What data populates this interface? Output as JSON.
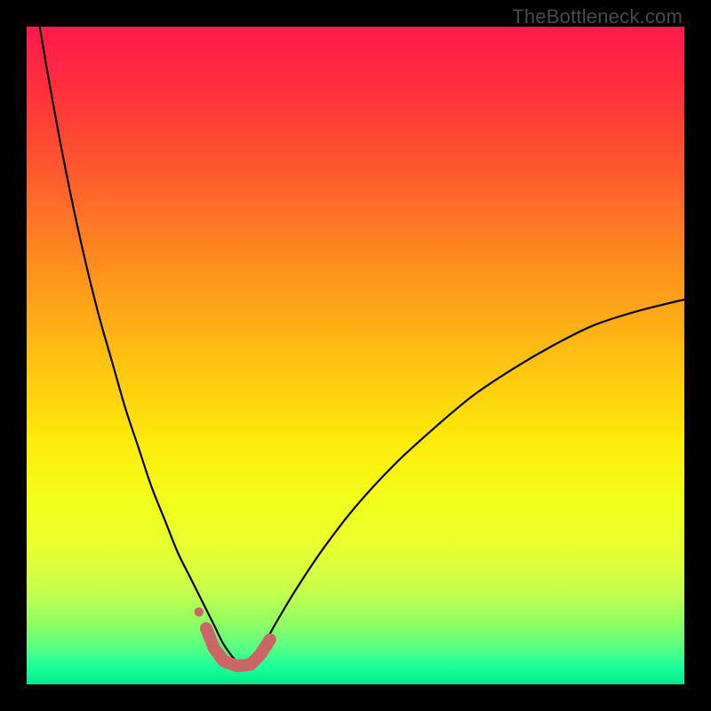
{
  "watermark": "TheBottleneck.com",
  "chart_data": {
    "type": "line",
    "title": "",
    "xlabel": "",
    "ylabel": "",
    "xlim": [
      0,
      1
    ],
    "ylim": [
      0,
      1
    ],
    "background_gradient": {
      "description": "Vertical gradient from red (top) through orange/yellow to green (bottom)",
      "stops": [
        {
          "offset": 0.0,
          "color": "#ff1a4d"
        },
        {
          "offset": 0.08,
          "color": "#ff2b3f"
        },
        {
          "offset": 0.2,
          "color": "#ff5330"
        },
        {
          "offset": 0.35,
          "color": "#ff8a1f"
        },
        {
          "offset": 0.5,
          "color": "#ffbf12"
        },
        {
          "offset": 0.62,
          "color": "#ffe80a"
        },
        {
          "offset": 0.72,
          "color": "#f3ff1a"
        },
        {
          "offset": 0.8,
          "color": "#e6ff33"
        },
        {
          "offset": 0.86,
          "color": "#c4ff4d"
        },
        {
          "offset": 0.91,
          "color": "#8cff66"
        },
        {
          "offset": 0.95,
          "color": "#4dff88"
        },
        {
          "offset": 0.975,
          "color": "#1aff99"
        },
        {
          "offset": 1.0,
          "color": "#00e88a"
        }
      ]
    },
    "series": [
      {
        "name": "bottleneck-curve",
        "description": "V-shaped bottleneck curve; y≈1 at x≈0 descending steeply to minimum near x≈0.30–0.34, rising toward y≈0.58 at x=1",
        "x": [
          0.02,
          0.03,
          0.05,
          0.07,
          0.09,
          0.11,
          0.13,
          0.15,
          0.17,
          0.19,
          0.21,
          0.23,
          0.25,
          0.27,
          0.285,
          0.3,
          0.32,
          0.34,
          0.36,
          0.38,
          0.41,
          0.45,
          0.5,
          0.56,
          0.62,
          0.68,
          0.74,
          0.8,
          0.86,
          0.92,
          0.97,
          1.0
        ],
        "values": [
          1.0,
          0.94,
          0.83,
          0.73,
          0.64,
          0.56,
          0.49,
          0.42,
          0.36,
          0.3,
          0.25,
          0.2,
          0.16,
          0.12,
          0.09,
          0.06,
          0.035,
          0.035,
          0.06,
          0.095,
          0.145,
          0.205,
          0.27,
          0.335,
          0.39,
          0.44,
          0.48,
          0.515,
          0.545,
          0.565,
          0.578,
          0.585
        ]
      }
    ],
    "annotations": [
      {
        "name": "minimum-marker",
        "type": "thick-segment",
        "color": "#cc6666",
        "points_x": [
          0.273,
          0.285,
          0.3,
          0.32,
          0.34,
          0.355,
          0.37
        ],
        "points_y": [
          0.085,
          0.055,
          0.035,
          0.028,
          0.03,
          0.045,
          0.068
        ]
      },
      {
        "name": "marker-dot",
        "type": "dot",
        "color": "#cc6666",
        "x": 0.262,
        "y": 0.11,
        "r": 0.007
      }
    ]
  }
}
